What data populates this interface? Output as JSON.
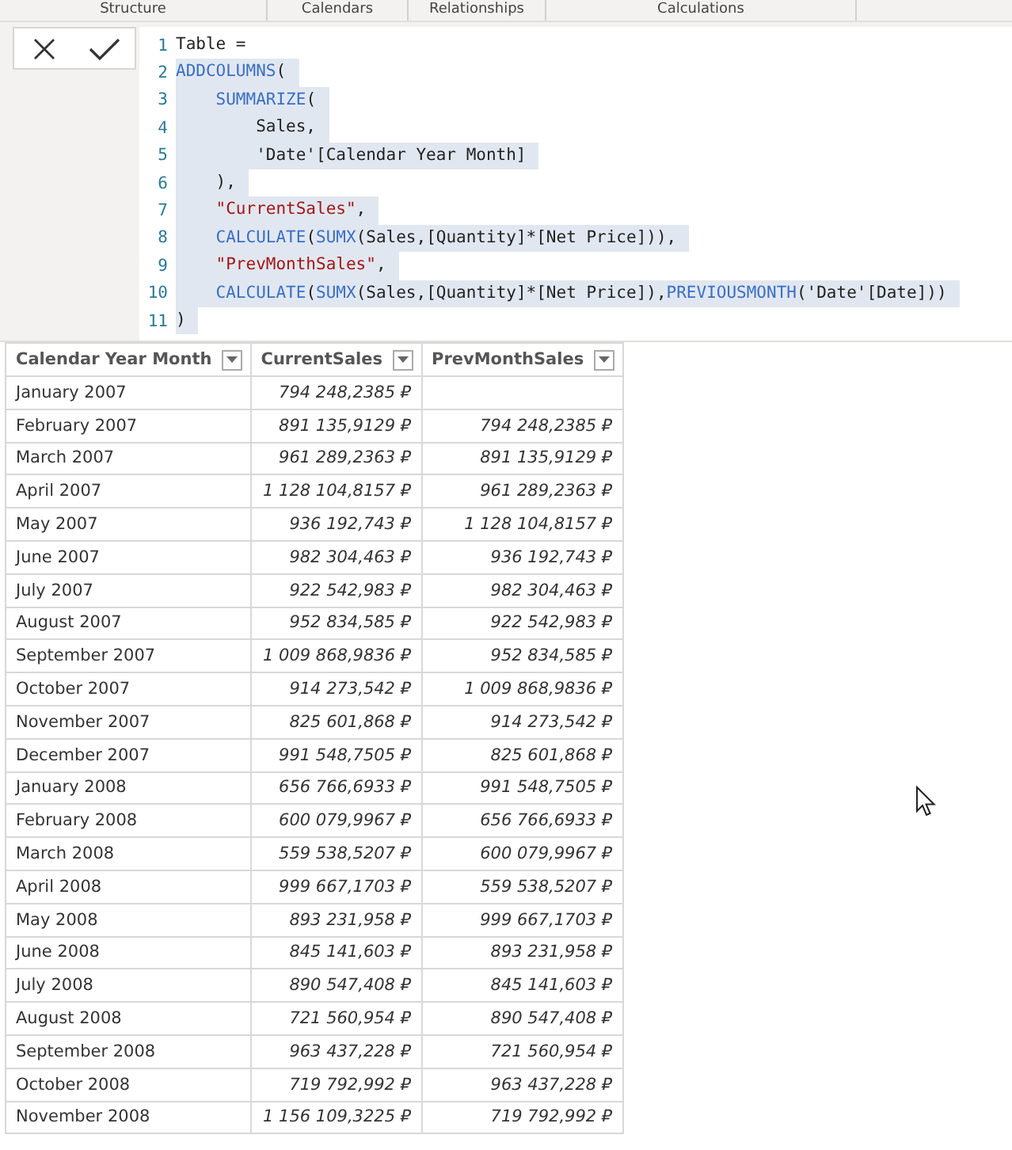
{
  "ribbon_groups": [
    "Structure",
    "Calendars",
    "Relationships",
    "Calculations"
  ],
  "formula_buttons": [
    {
      "kind": "cancel"
    },
    {
      "kind": "commit"
    }
  ],
  "code_lines": [
    {
      "number": "1",
      "selected": false,
      "tokens": [
        {
          "kind": "plain",
          "text": "Table ="
        }
      ]
    },
    {
      "number": "2",
      "selected": true,
      "tokens": [
        {
          "kind": "function",
          "text": "ADDCOLUMNS"
        },
        {
          "kind": "plain",
          "text": "("
        }
      ],
      "children": [
        {
          "number": "3",
          "selected": true,
          "tokens": [
            {
              "kind": "function",
              "text": "SUMMARIZE"
            },
            {
              "kind": "plain",
              "text": "("
            }
          ],
          "children": [
            {
              "number": "4",
              "selected": true,
              "tokens": [
                {
                  "kind": "plain",
                  "text": "Sales,"
                }
              ]
            },
            {
              "number": "5",
              "selected": true,
              "tokens": [
                {
                  "kind": "plain",
                  "text": "'Date'[Calendar Year Month]"
                }
              ]
            }
          ]
        },
        {
          "number": "6",
          "selected": true,
          "tokens": [
            {
              "kind": "plain",
              "text": "),"
            }
          ]
        },
        {
          "number": "7",
          "selected": true,
          "tokens": [
            {
              "kind": "string",
              "text": "\"CurrentSales\""
            },
            {
              "kind": "plain",
              "text": ","
            }
          ]
        },
        {
          "number": "8",
          "selected": true,
          "tokens": [
            {
              "kind": "function",
              "text": "CALCULATE"
            },
            {
              "kind": "plain",
              "text": "("
            },
            {
              "kind": "function",
              "text": "SUMX"
            },
            {
              "kind": "plain",
              "text": "(Sales,[Quantity]*[Net Price])),"
            }
          ]
        },
        {
          "number": "9",
          "selected": true,
          "tokens": [
            {
              "kind": "string",
              "text": "\"PrevMonthSales\""
            },
            {
              "kind": "plain",
              "text": ","
            }
          ]
        },
        {
          "number": "10",
          "selected": true,
          "tokens": [
            {
              "kind": "function",
              "text": "CALCULATE"
            },
            {
              "kind": "plain",
              "text": "("
            },
            {
              "kind": "function",
              "text": "SUMX"
            },
            {
              "kind": "plain",
              "text": "(Sales,[Quantity]*[Net Price]),"
            },
            {
              "kind": "function",
              "text": "PREVIOUSMONTH"
            },
            {
              "kind": "plain",
              "text": "('Date'[Date]))"
            }
          ]
        }
      ]
    },
    {
      "number": "11",
      "selected": true,
      "tokens": [
        {
          "kind": "plain",
          "text": ")"
        }
      ]
    }
  ],
  "table": {
    "columns": [
      "Calendar Year Month",
      "CurrentSales",
      "PrevMonthSales"
    ],
    "rows": [
      [
        "January 2007",
        "794 248,2385 ₽"
      ],
      [
        "February 2007",
        "891 135,9129 ₽",
        "794 248,2385 ₽"
      ],
      [
        "March 2007",
        "961 289,2363 ₽",
        "891 135,9129 ₽"
      ],
      [
        "April 2007",
        "1 128 104,8157 ₽",
        "961 289,2363 ₽"
      ],
      [
        "May 2007",
        "936 192,743 ₽",
        "1 128 104,8157 ₽"
      ],
      [
        "June 2007",
        "982 304,463 ₽",
        "936 192,743 ₽"
      ],
      [
        "July 2007",
        "922 542,983 ₽",
        "982 304,463 ₽"
      ],
      [
        "August 2007",
        "952 834,585 ₽",
        "922 542,983 ₽"
      ],
      [
        "September 2007",
        "1 009 868,9836 ₽",
        "952 834,585 ₽"
      ],
      [
        "October 2007",
        "914 273,542 ₽",
        "1 009 868,9836 ₽"
      ],
      [
        "November 2007",
        "825 601,868 ₽",
        "914 273,542 ₽"
      ],
      [
        "December 2007",
        "991 548,7505 ₽",
        "825 601,868 ₽"
      ],
      [
        "January 2008",
        "656 766,6933 ₽",
        "991 548,7505 ₽"
      ],
      [
        "February 2008",
        "600 079,9967 ₽",
        "656 766,6933 ₽"
      ],
      [
        "March 2008",
        "559 538,5207 ₽",
        "600 079,9967 ₽"
      ],
      [
        "April 2008",
        "999 667,1703 ₽",
        "559 538,5207 ₽"
      ],
      [
        "May 2008",
        "893 231,958 ₽",
        "999 667,1703 ₽"
      ],
      [
        "June 2008",
        "845 141,603 ₽",
        "893 231,958 ₽"
      ],
      [
        "July 2008",
        "890 547,408 ₽",
        "845 141,603 ₽"
      ],
      [
        "August 2008",
        "721 560,954 ₽",
        "890 547,408 ₽"
      ],
      [
        "September 2008",
        "963 437,228 ₽",
        "721 560,954 ₽"
      ],
      [
        "October 2008",
        "719 792,992 ₽",
        "963 437,228 ₽"
      ],
      [
        "November 2008",
        "1 156 109,3225 ₽",
        "719 792,992 ₽"
      ]
    ]
  }
}
